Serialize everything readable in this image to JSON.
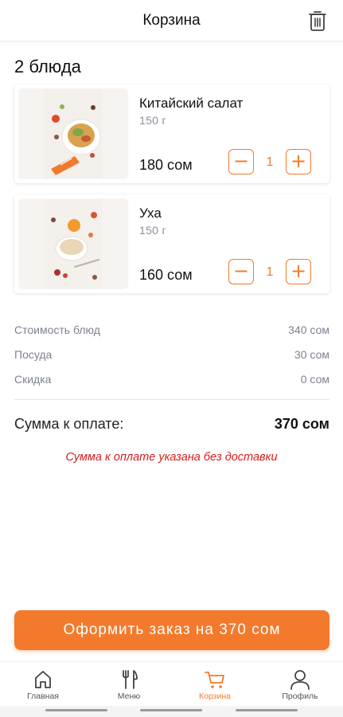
{
  "header": {
    "title": "Корзина"
  },
  "cart": {
    "count_label": "2 блюда",
    "items": [
      {
        "name": "Китайский салат",
        "weight": "150 г",
        "price": "180 сом",
        "quantity": "1",
        "minus": "−",
        "plus": "+"
      },
      {
        "name": "Уха",
        "weight": "150 г",
        "price": "160 сом",
        "quantity": "1",
        "minus": "−",
        "plus": "+"
      }
    ]
  },
  "summary": {
    "rows": [
      {
        "label": "Стоимость блюд",
        "value": "340 сом"
      },
      {
        "label": "Посуда",
        "value": "30 сом"
      },
      {
        "label": "Скидка",
        "value": "0 сом"
      }
    ],
    "total_label": "Сумма к оплате:",
    "total_value": "370 сом",
    "note": "Сумма к оплате указана без доставки"
  },
  "order_button": {
    "label": "Оформить заказ на 370 сом"
  },
  "tabbar": {
    "tabs": [
      {
        "label": "Главная",
        "icon": "home-icon"
      },
      {
        "label": "Меню",
        "icon": "cutlery-icon"
      },
      {
        "label": "Корзина",
        "icon": "cart-icon",
        "active": true
      },
      {
        "label": "Профиль",
        "icon": "user-icon"
      }
    ]
  },
  "colors": {
    "accent": "#f37a2c",
    "note": "#d81b1b",
    "muted": "#7d8291"
  }
}
